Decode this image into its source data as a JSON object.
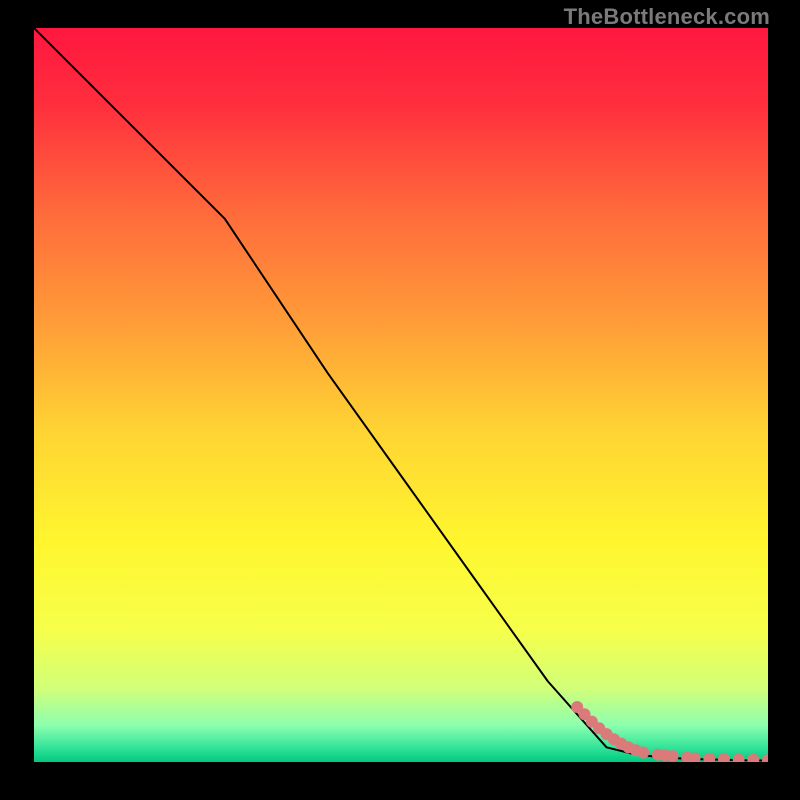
{
  "watermark": "TheBottleneck.com",
  "chart_data": {
    "type": "line",
    "title": "",
    "xlabel": "",
    "ylabel": "",
    "xlim": [
      0,
      100
    ],
    "ylim": [
      0,
      100
    ],
    "grid": false,
    "legend": false,
    "background_gradient": {
      "stops": [
        {
          "pos": 0.0,
          "color": "#ff173f"
        },
        {
          "pos": 0.1,
          "color": "#ff2d3e"
        },
        {
          "pos": 0.25,
          "color": "#ff6a3b"
        },
        {
          "pos": 0.4,
          "color": "#ff9c38"
        },
        {
          "pos": 0.55,
          "color": "#ffd433"
        },
        {
          "pos": 0.7,
          "color": "#fff62f"
        },
        {
          "pos": 0.82,
          "color": "#f6ff4a"
        },
        {
          "pos": 0.9,
          "color": "#d1ff7a"
        },
        {
          "pos": 0.95,
          "color": "#8dffae"
        },
        {
          "pos": 0.98,
          "color": "#33e49a"
        },
        {
          "pos": 1.0,
          "color": "#00c97f"
        }
      ]
    },
    "series": [
      {
        "name": "curve",
        "color": "#000000",
        "stroke_width": 2,
        "x": [
          0,
          10,
          20,
          26,
          30,
          40,
          50,
          60,
          70,
          78,
          82,
          86,
          90,
          94,
          98,
          100
        ],
        "y": [
          100,
          90,
          80,
          74,
          68,
          53,
          39,
          25,
          11,
          2,
          1,
          0.6,
          0.4,
          0.3,
          0.2,
          0.2
        ]
      },
      {
        "name": "markers",
        "type": "scatter",
        "color": "#db7a7a",
        "radius": 6,
        "x": [
          74,
          75,
          76,
          77,
          78,
          79,
          80,
          81,
          82,
          83,
          85,
          86,
          87,
          89,
          90,
          92,
          94,
          96,
          98,
          100
        ],
        "y": [
          7.5,
          6.5,
          5.5,
          4.6,
          3.8,
          3.1,
          2.5,
          2.0,
          1.6,
          1.3,
          1.0,
          0.9,
          0.8,
          0.6,
          0.5,
          0.45,
          0.4,
          0.35,
          0.3,
          0.25
        ]
      }
    ]
  }
}
